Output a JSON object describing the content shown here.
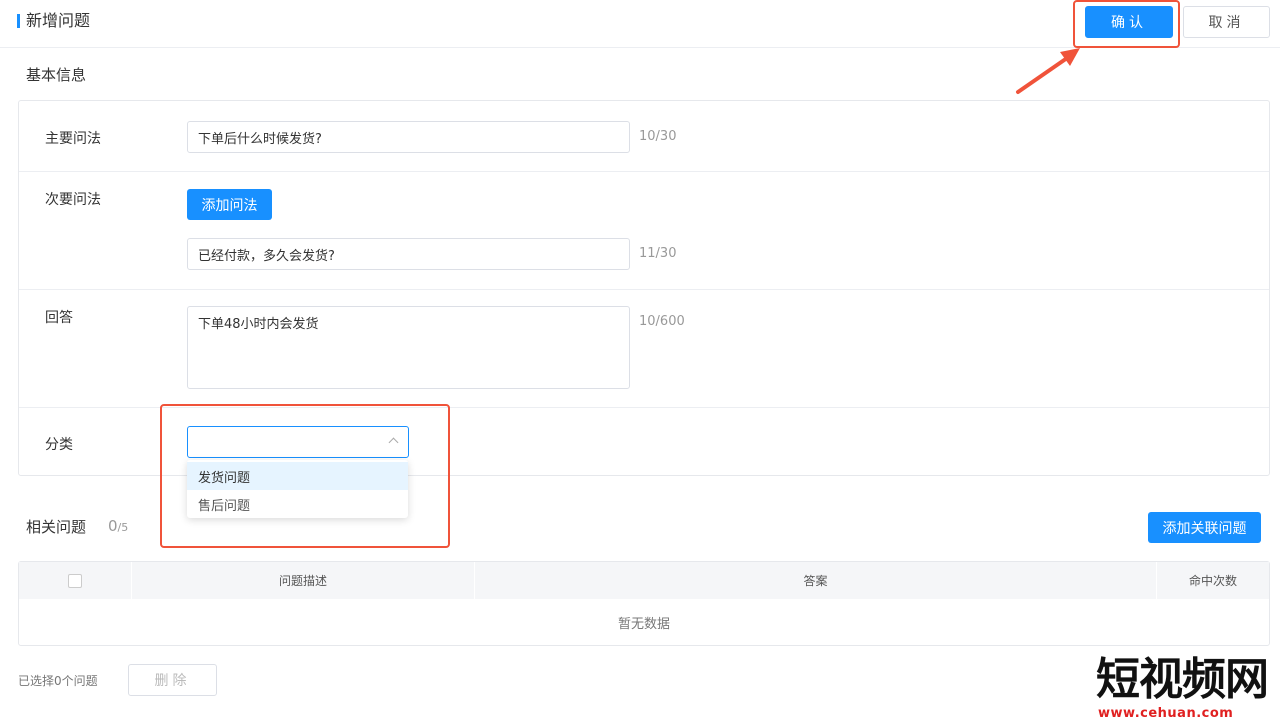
{
  "header": {
    "title": "新增问题",
    "confirm_label": "确认",
    "cancel_label": "取消"
  },
  "basic_info": {
    "section_title": "基本信息",
    "main_question": {
      "label": "主要问法",
      "value": "下单后什么时候发货?",
      "counter": "10/30"
    },
    "secondary_question": {
      "label": "次要问法",
      "add_button": "添加问法",
      "value": "已经付款，多久会发货?",
      "counter": "11/30"
    },
    "answer": {
      "label": "回答",
      "value": "下单48小时内会发货",
      "counter": "10/600"
    },
    "category": {
      "label": "分类",
      "value": "",
      "options": [
        "发货问题",
        "售后问题"
      ]
    }
  },
  "related": {
    "title": "相关问题",
    "count": "0",
    "max": "/5",
    "add_button": "添加关联问题",
    "columns": [
      "问题描述",
      "答案",
      "命中次数"
    ],
    "empty_text": "暂无数据",
    "selected_text": "已选择0个问题",
    "delete_label": "删除"
  },
  "watermark": {
    "main": "短视频网",
    "sub": "www.cehuan.com"
  },
  "colors": {
    "primary": "#1890ff",
    "highlight": "#f0533a",
    "border": "#dcdfe6"
  }
}
